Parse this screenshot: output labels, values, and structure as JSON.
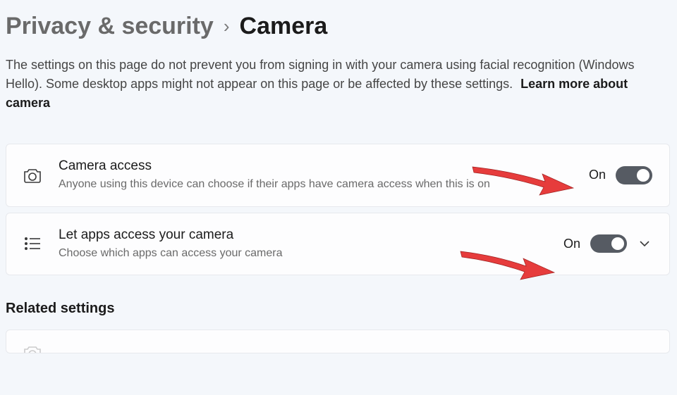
{
  "breadcrumb": {
    "parent": "Privacy & security",
    "current": "Camera"
  },
  "description": {
    "text": "The settings on this page do not prevent you from signing in with your camera using facial recognition (Windows Hello). Some desktop apps might not appear on this page or be affected by these settings.",
    "learn_more_label": "Learn more about camera"
  },
  "settings": [
    {
      "title": "Camera access",
      "subtitle": "Anyone using this device can choose if their apps have camera access when this is on",
      "state_label": "On",
      "toggle_on": true,
      "expandable": false
    },
    {
      "title": "Let apps access your camera",
      "subtitle": "Choose which apps can access your camera",
      "state_label": "On",
      "toggle_on": true,
      "expandable": true
    }
  ],
  "related": {
    "heading": "Related settings"
  },
  "colors": {
    "toggle_track": "#565b63",
    "background": "#f4f7fb",
    "card_bg": "#fdfdfe",
    "arrow_fill": "#e63c3c"
  }
}
